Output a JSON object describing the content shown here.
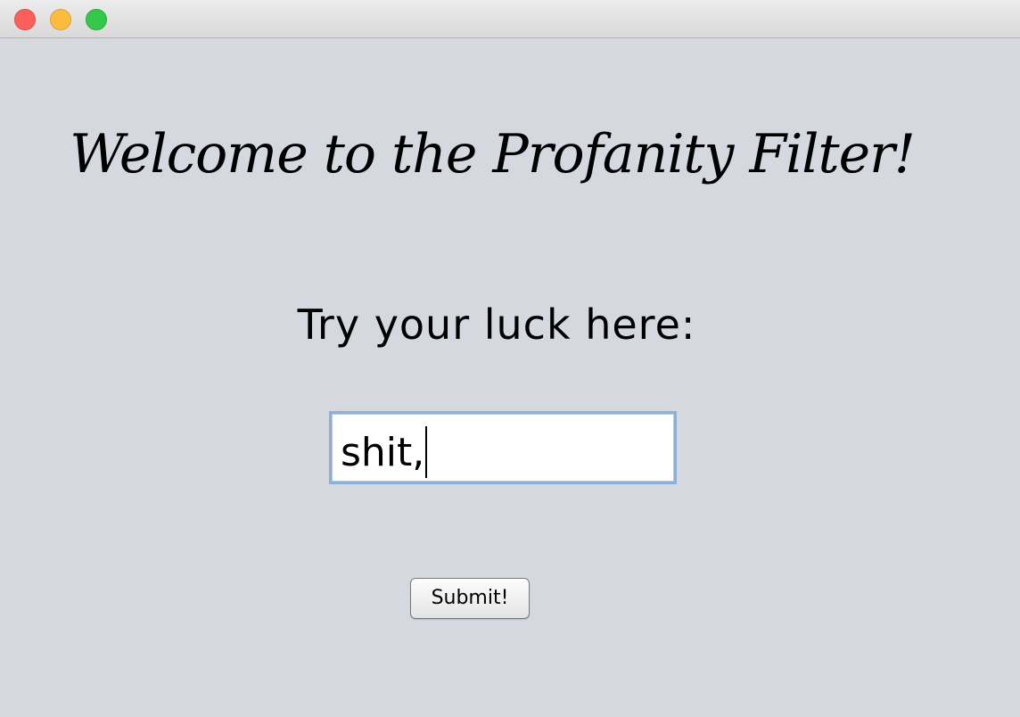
{
  "window": {
    "title": ""
  },
  "main": {
    "heading": "Welcome to the Profanity Filter!",
    "prompt": "Try your luck here:",
    "input_value": "shit,",
    "submit_label": "Submit!"
  },
  "colors": {
    "background": "#d6d8e0",
    "close": "#fc605b",
    "minimize": "#fdbc40",
    "maximize": "#34c84a",
    "input_focus_border": "#8fb0d6"
  }
}
